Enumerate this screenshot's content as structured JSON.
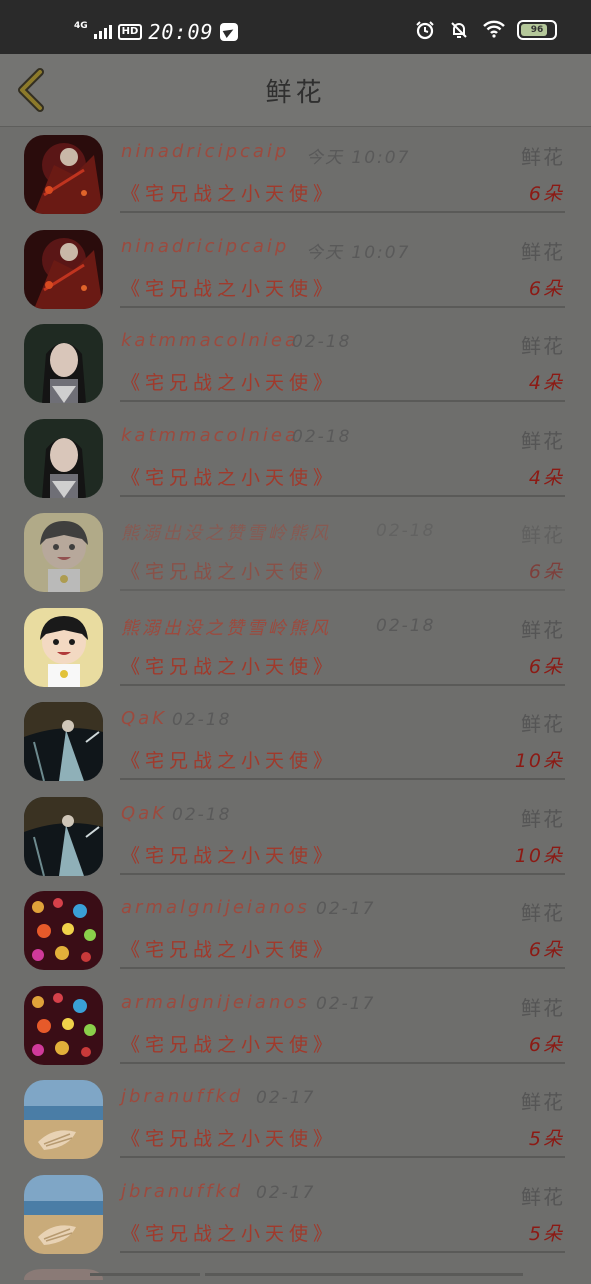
{
  "status_bar": {
    "network": "4G",
    "hd": "HD",
    "time": "20:09",
    "battery": "96"
  },
  "header": {
    "title": "鲜花"
  },
  "colors": {
    "name": "#9c4a3e",
    "count": "#8c1a14",
    "background": "#6e6e6c"
  },
  "records": [
    {
      "user": "ninadricipcaip",
      "time": "今天 10:07",
      "type": "鲜花",
      "book": "《宅兄战之小天使》",
      "count": "6朵",
      "avatar": "dark-red-art"
    },
    {
      "user": "ninadricipcaip",
      "time": "今天 10:07",
      "type": "鲜花",
      "book": "《宅兄战之小天使》",
      "count": "6朵",
      "avatar": "dark-red-art"
    },
    {
      "user": "katmmacolniea",
      "time": "02-18",
      "type": "鲜花",
      "book": "《宅兄战之小天使》",
      "count": "4朵",
      "avatar": "girl-portrait"
    },
    {
      "user": "katmmacolniea",
      "time": "02-18",
      "type": "鲜花",
      "book": "《宅兄战之小天使》",
      "count": "4朵",
      "avatar": "girl-portrait"
    },
    {
      "user": "熊溺出没之赞雪岭熊风",
      "time": "02-18",
      "type": "鲜花",
      "book": "《宅兄战之小天使》",
      "count": "6朵",
      "avatar": "cartoon-girl"
    },
    {
      "user": "熊溺出没之赞雪岭熊风",
      "time": "02-18",
      "type": "鲜花",
      "book": "《宅兄战之小天使》",
      "count": "6朵",
      "avatar": "cartoon-girl"
    },
    {
      "user": "QaK",
      "time": "02-18",
      "type": "鲜花",
      "book": "《宅兄战之小天使》",
      "count": "10朵",
      "avatar": "ancient-figure"
    },
    {
      "user": "QaK",
      "time": "02-18",
      "type": "鲜花",
      "book": "《宅兄战之小天使》",
      "count": "10朵",
      "avatar": "ancient-figure"
    },
    {
      "user": "armalgnijeianos",
      "time": "02-17",
      "type": "鲜花",
      "book": "《宅兄战之小天使》",
      "count": "6朵",
      "avatar": "bokeh-lights"
    },
    {
      "user": "armalgnijeianos",
      "time": "02-17",
      "type": "鲜花",
      "book": "《宅兄战之小天使》",
      "count": "6朵",
      "avatar": "bokeh-lights"
    },
    {
      "user": "jbranuffkd",
      "time": "02-17",
      "type": "鲜花",
      "book": "《宅兄战之小天使》",
      "count": "5朵",
      "avatar": "seashell-beach"
    },
    {
      "user": "jbranuffkd",
      "time": "02-17",
      "type": "鲜花",
      "book": "《宅兄战之小天使》",
      "count": "5朵",
      "avatar": "seashell-beach"
    }
  ]
}
